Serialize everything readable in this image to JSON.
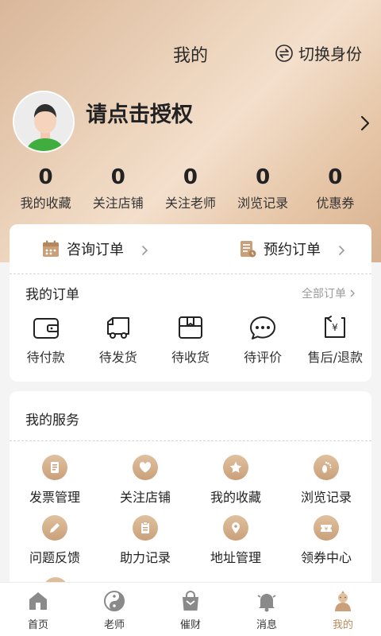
{
  "header": {
    "title": "我的",
    "switch_label": "切换身份"
  },
  "profile": {
    "auth_prompt": "请点击授权"
  },
  "stats": [
    {
      "value": "0",
      "label": "我的收藏"
    },
    {
      "value": "0",
      "label": "关注店铺"
    },
    {
      "value": "0",
      "label": "关注老师"
    },
    {
      "value": "0",
      "label": "浏览记录"
    },
    {
      "value": "0",
      "label": "优惠券"
    }
  ],
  "quick_orders": {
    "consult": "咨询订单",
    "booking": "预约订单"
  },
  "my_orders": {
    "title": "我的订单",
    "view_all": "全部订单",
    "items": [
      {
        "label": "待付款",
        "icon": "wallet-icon"
      },
      {
        "label": "待发货",
        "icon": "truck-icon"
      },
      {
        "label": "待收货",
        "icon": "package-icon"
      },
      {
        "label": "待评价",
        "icon": "comment-icon"
      },
      {
        "label": "售后/退款",
        "icon": "refund-icon"
      }
    ]
  },
  "services": {
    "title": "我的服务",
    "items": [
      {
        "label": "发票管理",
        "icon": "invoice-icon"
      },
      {
        "label": "关注店铺",
        "icon": "heart-icon"
      },
      {
        "label": "我的收藏",
        "icon": "star-icon"
      },
      {
        "label": "浏览记录",
        "icon": "footprint-icon"
      },
      {
        "label": "问题反馈",
        "icon": "pencil-icon"
      },
      {
        "label": "助力记录",
        "icon": "clipboard-icon"
      },
      {
        "label": "地址管理",
        "icon": "location-icon"
      },
      {
        "label": "领券中心",
        "icon": "coupon-icon"
      }
    ]
  },
  "tabbar": [
    {
      "label": "首页",
      "icon": "home-icon",
      "active": false
    },
    {
      "label": "老师",
      "icon": "yin-yang-icon",
      "active": false
    },
    {
      "label": "催财",
      "icon": "shopping-bag-icon",
      "active": false
    },
    {
      "label": "消息",
      "icon": "bell-icon",
      "active": false
    },
    {
      "label": "我的",
      "icon": "monk-icon",
      "active": true
    }
  ],
  "colors": {
    "accent": "#b98a5c",
    "icon_gold": "#c9a07a",
    "header_bg": "#e6c6a7"
  }
}
